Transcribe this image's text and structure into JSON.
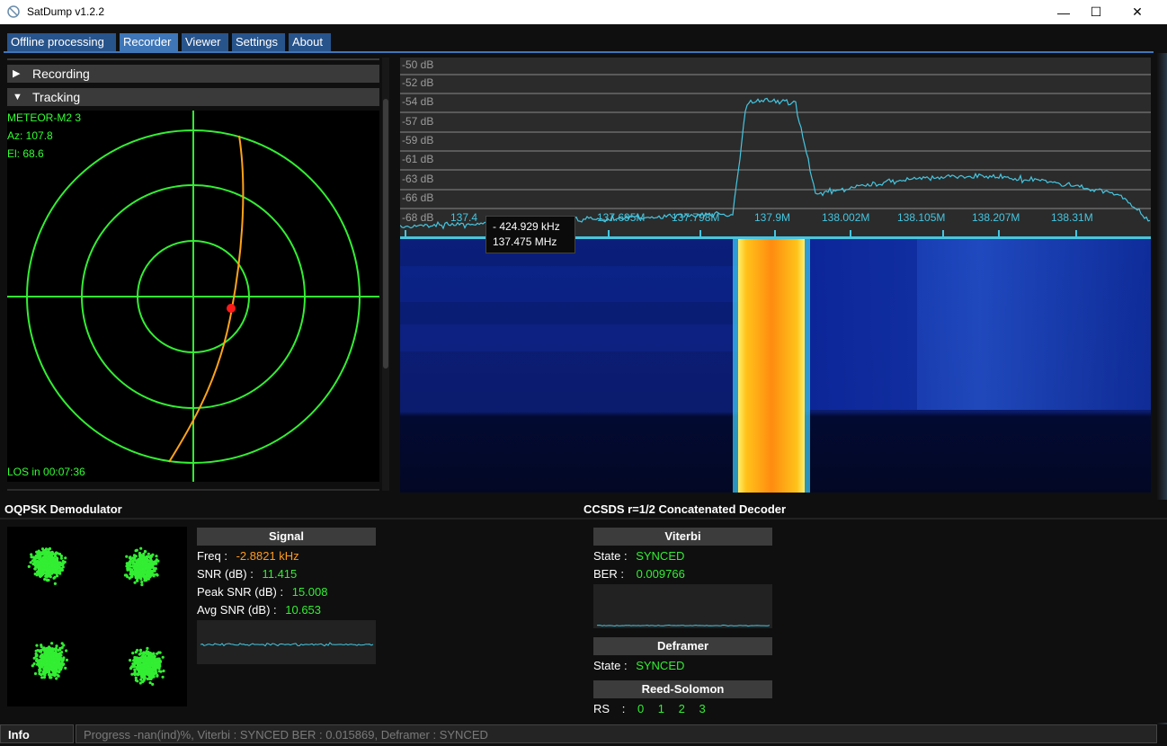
{
  "window": {
    "title": "SatDump v1.2.2",
    "minimize": "—",
    "maximize": "☐",
    "close": "✕"
  },
  "tabs": [
    {
      "label": "Offline processing"
    },
    {
      "label": "Recorder"
    },
    {
      "label": "Viewer"
    },
    {
      "label": "Settings"
    },
    {
      "label": "About"
    }
  ],
  "active_tab": "Recorder",
  "sections": {
    "recording": {
      "label": "Recording",
      "icon": "triangle-right-icon"
    },
    "tracking": {
      "label": "Tracking",
      "icon": "triangle-down-icon"
    }
  },
  "tracking": {
    "satellite": "METEOR-M2 3",
    "az": "Az: 107.8",
    "el": "El: 68.6",
    "los": "LOS in 00:07:36"
  },
  "fft": {
    "db_labels": [
      "-50 dB",
      "-52 dB",
      "-54 dB",
      "-57 dB",
      "-59 dB",
      "-61 dB",
      "-63 dB",
      "-66 dB",
      "-68 dB"
    ],
    "freq_labels": [
      "137.4",
      "137.695M",
      "137.798M",
      "137.9M",
      "138.002M",
      "138.105M",
      "138.207M",
      "138.31M"
    ],
    "tooltip": {
      "offset": "- 424.929 kHz",
      "freq": "137.475 MHz"
    }
  },
  "demod": {
    "title": "OQPSK Demodulator",
    "signal_header": "Signal",
    "freq_label": "Freq :",
    "freq_value": "-2.8821 kHz",
    "snr_label": "SNR (dB) :",
    "snr_value": "11.415",
    "peak_label": "Peak SNR (dB) :",
    "peak_value": "15.008",
    "avg_label": "Avg SNR (dB) :",
    "avg_value": "10.653"
  },
  "decoder": {
    "title": "CCSDS r=1/2 Concatenated Decoder",
    "viterbi_header": "Viterbi",
    "viterbi_state_label": "State :",
    "viterbi_state": "SYNCED",
    "ber_label": "BER :",
    "ber_value": "0.009766",
    "deframer_header": "Deframer",
    "deframer_state_label": "State :",
    "deframer_state": "SYNCED",
    "rs_header": "Reed-Solomon",
    "rs_label": "RS",
    "rs_sep": ":",
    "rs_values": [
      "0",
      "1",
      "2",
      "3"
    ]
  },
  "status": {
    "label": "Info",
    "text": "Progress -nan(ind)%, Viterbi : SYNCED BER : 0.015869, Deframer : SYNCED"
  },
  "colors": {
    "accent": "#3e76b8",
    "green": "#33ee33",
    "orange": "#ff9a1f",
    "cyan": "#45c6e0"
  }
}
